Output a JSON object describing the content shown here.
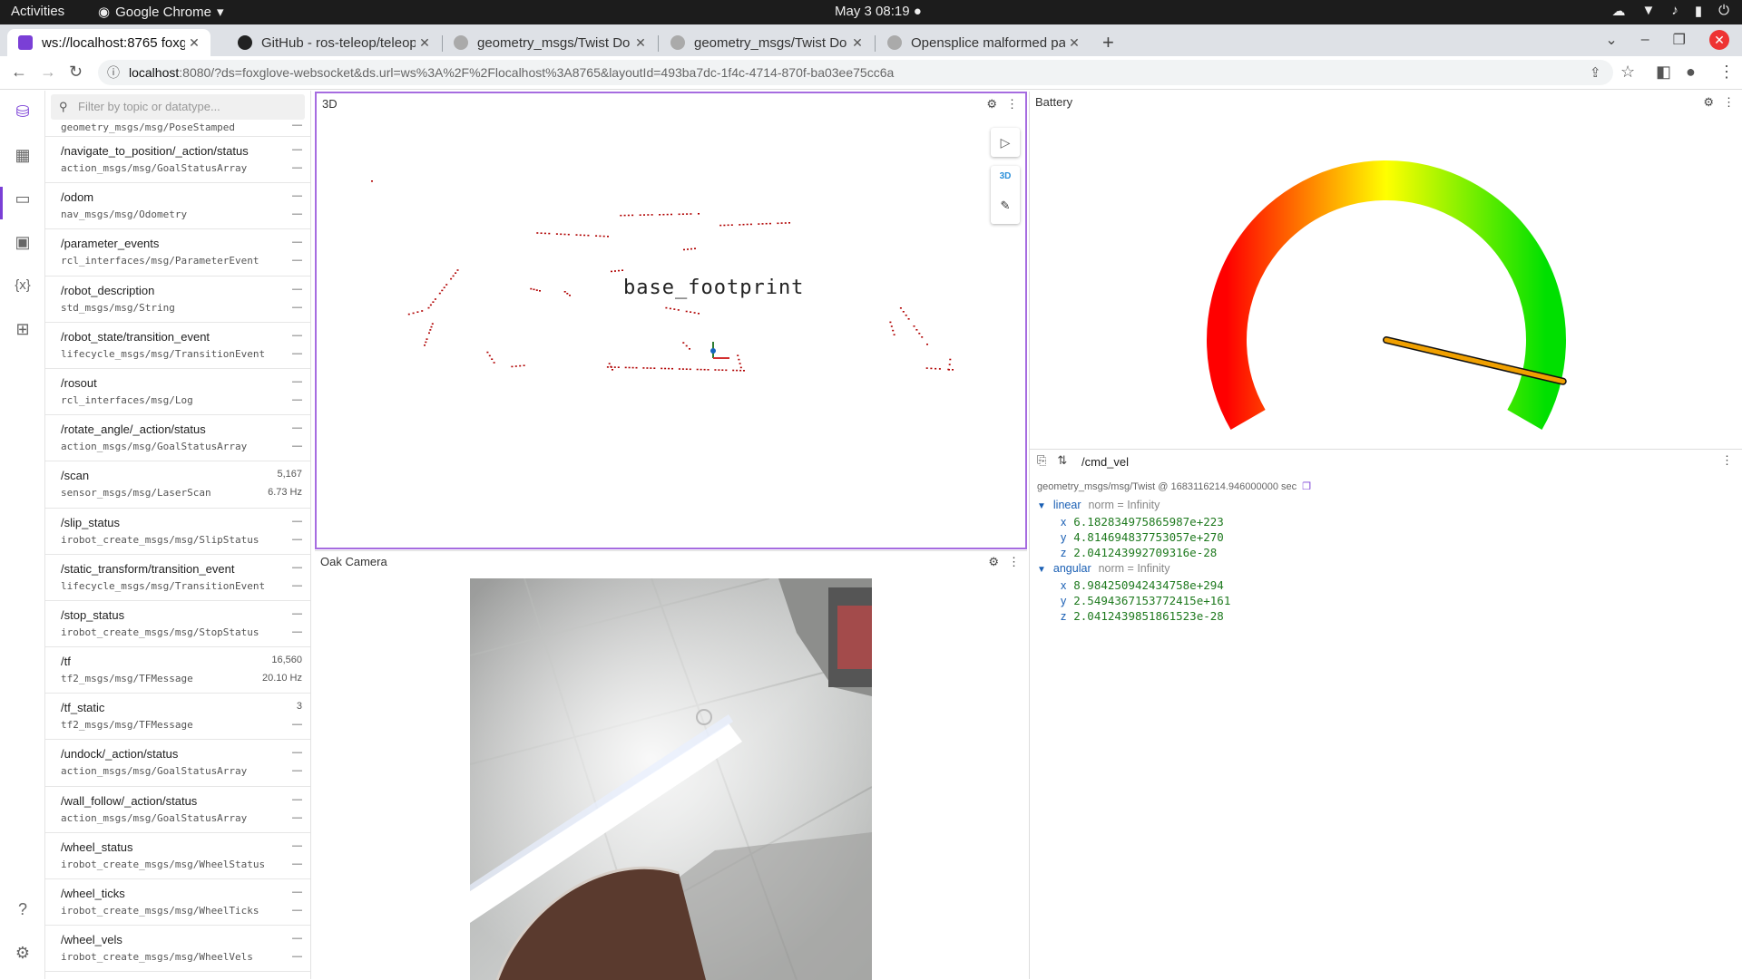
{
  "system": {
    "activities": "Activities",
    "app_name": "Google Chrome",
    "clock": "May 3  08:19"
  },
  "browser": {
    "tabs": [
      {
        "title": "ws://localhost:8765 foxglove",
        "active": true
      },
      {
        "title": "GitHub - ros-teleop/teleop",
        "active": false
      },
      {
        "title": "geometry_msgs/Twist Do",
        "active": false
      },
      {
        "title": "geometry_msgs/Twist Do",
        "active": false
      },
      {
        "title": "Opensplice malformed pa",
        "active": false
      }
    ],
    "url_host": "localhost",
    "url_rest": ":8080/?ds=foxglove-websocket&ds.url=ws%3A%2F%2Flocalhost%3A8765&layoutId=493ba7dc-1f4c-4714-870f-ba03ee75cc6a"
  },
  "sidebar": {
    "filter_placeholder": "Filter by topic or datatype...",
    "partial_row": {
      "type": "geometry_msgs/msg/PoseStamped",
      "c1": "—"
    },
    "topics": [
      {
        "name": "/navigate_to_position/_action/status",
        "type": "action_msgs/msg/GoalStatusArray",
        "c1": "—",
        "c2": "—"
      },
      {
        "name": "/odom",
        "type": "nav_msgs/msg/Odometry",
        "c1": "—",
        "c2": "—"
      },
      {
        "name": "/parameter_events",
        "type": "rcl_interfaces/msg/ParameterEvent",
        "c1": "—",
        "c2": "—"
      },
      {
        "name": "/robot_description",
        "type": "std_msgs/msg/String",
        "c1": "—",
        "c2": "—"
      },
      {
        "name": "/robot_state/transition_event",
        "type": "lifecycle_msgs/msg/TransitionEvent",
        "c1": "—",
        "c2": "—"
      },
      {
        "name": "/rosout",
        "type": "rcl_interfaces/msg/Log",
        "c1": "—",
        "c2": "—"
      },
      {
        "name": "/rotate_angle/_action/status",
        "type": "action_msgs/msg/GoalStatusArray",
        "c1": "—",
        "c2": "—"
      },
      {
        "name": "/scan",
        "type": "sensor_msgs/msg/LaserScan",
        "c1": "5,167",
        "c2": "6.73 Hz"
      },
      {
        "name": "/slip_status",
        "type": "irobot_create_msgs/msg/SlipStatus",
        "c1": "—",
        "c2": "—"
      },
      {
        "name": "/static_transform/transition_event",
        "type": "lifecycle_msgs/msg/TransitionEvent",
        "c1": "—",
        "c2": "—"
      },
      {
        "name": "/stop_status",
        "type": "irobot_create_msgs/msg/StopStatus",
        "c1": "—",
        "c2": "—"
      },
      {
        "name": "/tf",
        "type": "tf2_msgs/msg/TFMessage",
        "c1": "16,560",
        "c2": "20.10 Hz"
      },
      {
        "name": "/tf_static",
        "type": "tf2_msgs/msg/TFMessage",
        "c1": "3",
        "c2": "—"
      },
      {
        "name": "/undock/_action/status",
        "type": "action_msgs/msg/GoalStatusArray",
        "c1": "—",
        "c2": "—"
      },
      {
        "name": "/wall_follow/_action/status",
        "type": "action_msgs/msg/GoalStatusArray",
        "c1": "—",
        "c2": "—"
      },
      {
        "name": "/wheel_status",
        "type": "irobot_create_msgs/msg/WheelStatus",
        "c1": "—",
        "c2": "—"
      },
      {
        "name": "/wheel_ticks",
        "type": "irobot_create_msgs/msg/WheelTicks",
        "c1": "—",
        "c2": "—"
      },
      {
        "name": "/wheel_vels",
        "type": "irobot_create_msgs/msg/WheelVels",
        "c1": "—",
        "c2": "—"
      }
    ]
  },
  "panels": {
    "three_d": {
      "title": "3D",
      "frame_label": "base_footprint",
      "mode_label": "3D"
    },
    "battery": {
      "title": "Battery",
      "gauge_fraction": 0.93
    },
    "camera": {
      "title": "Oak Camera"
    },
    "cmd_vel": {
      "topic": "/cmd_vel",
      "meta": "geometry_msgs/msg/Twist @ 1683116214.946000000 sec",
      "linear": {
        "label": "linear",
        "norm": "norm = Infinity",
        "x": "6.182834975865987e+223",
        "y": "4.814694837753057e+270",
        "z": "2.041243992709316e-28"
      },
      "angular": {
        "label": "angular",
        "norm": "norm = Infinity",
        "x": "8.984250942434758e+294",
        "y": "2.5494367153772415e+161",
        "z": "2.0412439851861523e-28"
      }
    }
  },
  "colors": {
    "accent": "#7a3fd6",
    "scan_points": "#b00000",
    "needle": "#f0a000"
  }
}
